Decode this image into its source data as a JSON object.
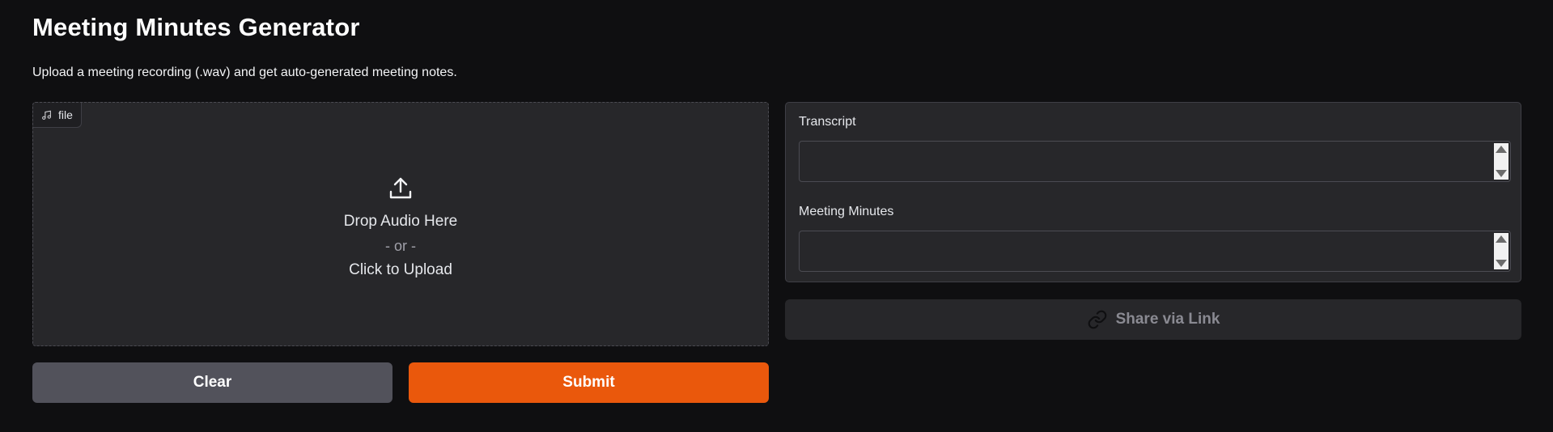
{
  "app": {
    "title": "Meeting Minutes Generator",
    "description": "Upload a meeting recording (.wav) and get auto-generated meeting notes."
  },
  "upload": {
    "chip_label": "file",
    "chip_icon": "music-note-icon",
    "upload_icon": "upload-icon",
    "drop_text": "Drop Audio Here",
    "or_text": "- or -",
    "click_text": "Click to Upload"
  },
  "buttons": {
    "clear_label": "Clear",
    "submit_label": "Submit",
    "submit_color": "#ea580c",
    "clear_color": "#52525b"
  },
  "outputs": {
    "transcript_label": "Transcript",
    "transcript_value": "",
    "minutes_label": "Meeting Minutes",
    "minutes_value": ""
  },
  "share": {
    "label": "Share via Link",
    "icon": "link-icon"
  },
  "colors": {
    "background": "#0f0f11",
    "panel": "#27272a",
    "accent": "#ea580c"
  }
}
